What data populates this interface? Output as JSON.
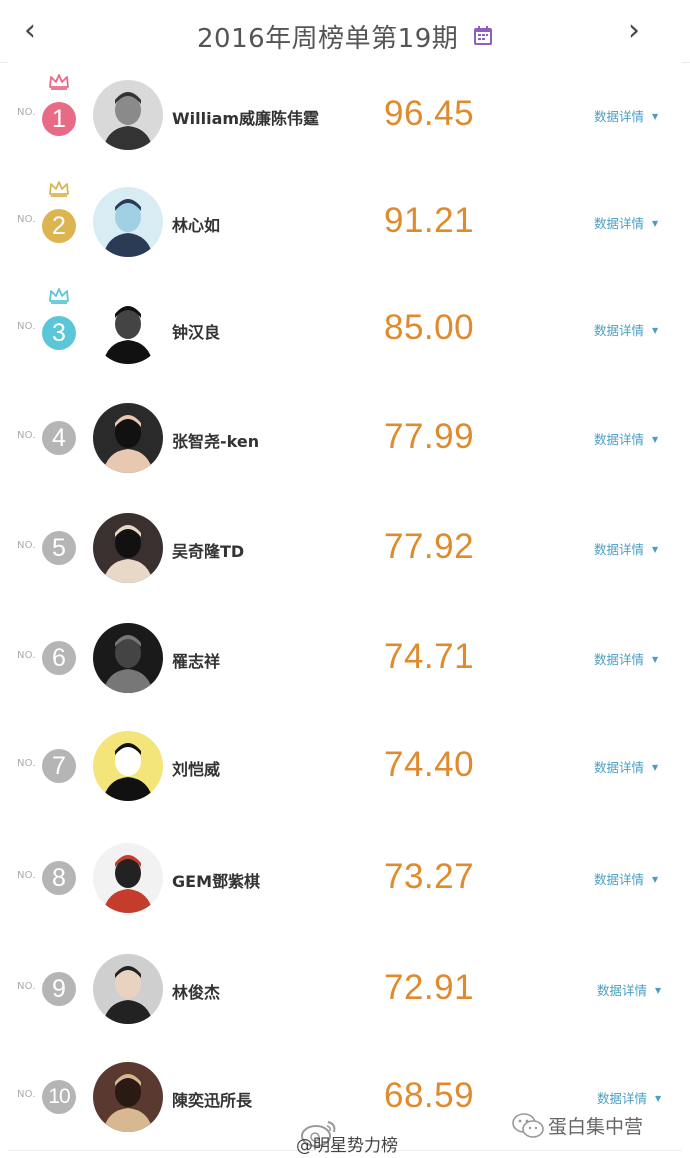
{
  "header": {
    "title": "2016年周榜单第19期",
    "prev_icon": "chevron-left-icon",
    "next_icon": "chevron-right-icon",
    "calendar_icon": "calendar-icon",
    "calendar_color": "#8e5fbf"
  },
  "no_label": "NO.",
  "detail_label": "数据详情",
  "colors": {
    "rank1": "#e86b86",
    "rank2": "#dcb550",
    "rank3": "#5bc6d8",
    "rank_other": "#b5b5b5",
    "score": "#e08a2e",
    "detail": "#4a9ec4"
  },
  "rankings": [
    {
      "rank": "1",
      "name": "William威廉陈伟霆",
      "score": "96.45"
    },
    {
      "rank": "2",
      "name": "林心如",
      "score": "91.21"
    },
    {
      "rank": "3",
      "name": "钟汉良",
      "score": "85.00"
    },
    {
      "rank": "4",
      "name": "张智尧-ken",
      "score": "77.99"
    },
    {
      "rank": "5",
      "name": "吴奇隆TD",
      "score": "77.92"
    },
    {
      "rank": "6",
      "name": "罹志祥",
      "score": "74.71"
    },
    {
      "rank": "7",
      "name": "刘恺威",
      "score": "74.40"
    },
    {
      "rank": "8",
      "name": "GEM鄧紫棋",
      "score": "73.27"
    },
    {
      "rank": "9",
      "name": "林俊杰",
      "score": "72.91"
    },
    {
      "rank": "10",
      "name": "陳奕迅所長",
      "score": "68.59"
    }
  ],
  "watermark": {
    "weibo_handle": "@明星势力榜",
    "wechat_account": "蛋白集中营"
  }
}
